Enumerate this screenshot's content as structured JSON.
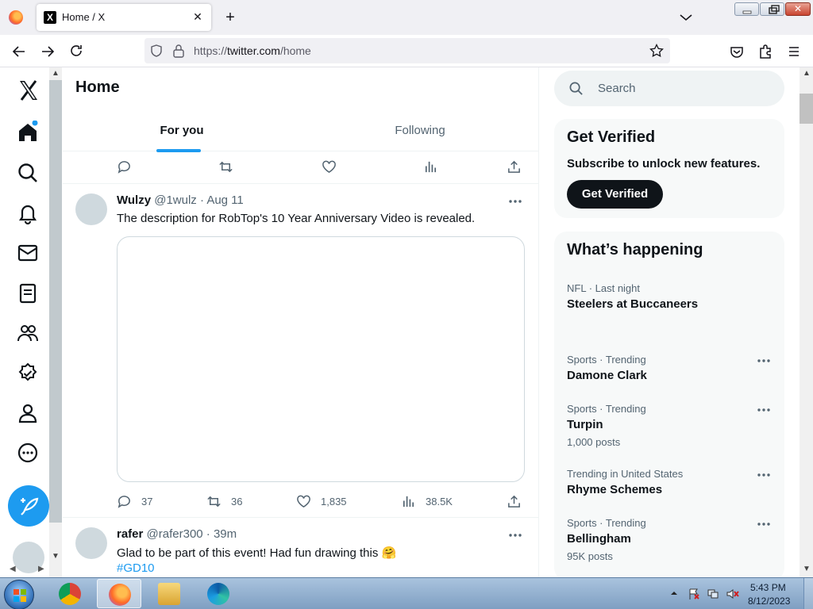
{
  "browser": {
    "tab_title": "Home / X",
    "tab_favicon": "X",
    "close_glyph": "✕",
    "newtab_glyph": "+",
    "url_scheme": "https://",
    "url_host": "twitter.com",
    "url_path": "/home"
  },
  "main": {
    "title": "Home",
    "tabs": [
      "For you",
      "Following"
    ]
  },
  "tweets": [
    {
      "name": "Wulzy",
      "handle": "@1wulz · Aug 11",
      "text": "The description for RobTop's 10 Year Anniversary Video is revealed.",
      "replies": "37",
      "retweets": "36",
      "likes": "1,835",
      "views": "38.5K"
    },
    {
      "name": "rafer",
      "handle": "@rafer300 · 39m",
      "text": "Glad to be part of this event! Had fun drawing this 🤗",
      "hashtag": "#GD10"
    }
  ],
  "sidebar": {
    "search_placeholder": "Search",
    "verified": {
      "title": "Get Verified",
      "subtitle": "Subscribe to unlock new features.",
      "button": "Get Verified"
    },
    "trends_title": "What’s happening",
    "trends": [
      {
        "meta": "NFL · Last night",
        "name": "Steelers at Buccaneers",
        "count": ""
      },
      {
        "meta": "Sports · Trending",
        "name": "Damone Clark",
        "count": ""
      },
      {
        "meta": "Sports · Trending",
        "name": "Turpin",
        "count": "1,000 posts"
      },
      {
        "meta": "Trending in United States",
        "name": "Rhyme Schemes",
        "count": ""
      },
      {
        "meta": "Sports · Trending",
        "name": "Bellingham",
        "count": "95K posts"
      }
    ]
  },
  "taskbar": {
    "time": "5:43 PM",
    "date": "8/12/2023"
  },
  "colors": {
    "accent": "#1d9bf0",
    "text_primary": "#0f1419",
    "text_secondary": "#536471"
  }
}
